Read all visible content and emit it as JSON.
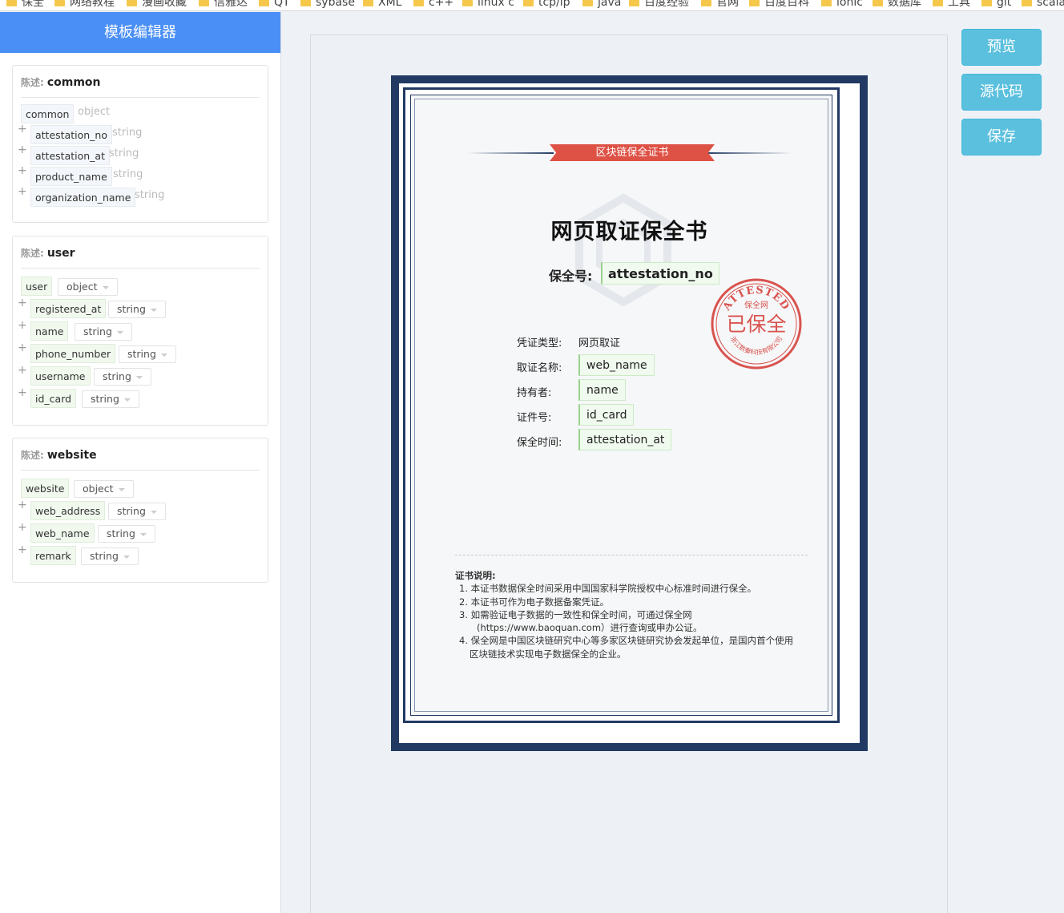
{
  "bookmarks": [
    "保全",
    "网络教程",
    "漫画收藏",
    "信雅达",
    "QT",
    "sybase",
    "XML",
    "c++",
    "linux c",
    "tcp/ip",
    "java",
    "百度经验",
    "官网",
    "百度百科",
    "ionic",
    "数据库",
    "工具",
    "git",
    "scala"
  ],
  "sidebar": {
    "title": "模板编辑器",
    "panels": [
      {
        "describe_label": "陈述:",
        "name": "common",
        "root": {
          "key": "common",
          "type": "object"
        },
        "fields": [
          {
            "key": "attestation_no",
            "type": "string"
          },
          {
            "key": "attestation_at",
            "type": "string"
          },
          {
            "key": "product_name",
            "type": "string"
          },
          {
            "key": "organization_name",
            "type": "string"
          }
        ]
      },
      {
        "describe_label": "陈述:",
        "name": "user",
        "root": {
          "key": "user",
          "type": "object"
        },
        "fields": [
          {
            "key": "registered_at",
            "type": "string"
          },
          {
            "key": "name",
            "type": "string"
          },
          {
            "key": "phone_number",
            "type": "string"
          },
          {
            "key": "username",
            "type": "string"
          },
          {
            "key": "id_card",
            "type": "string"
          }
        ]
      },
      {
        "describe_label": "陈述:",
        "name": "website",
        "root": {
          "key": "website",
          "type": "object"
        },
        "fields": [
          {
            "key": "web_address",
            "type": "string"
          },
          {
            "key": "web_name",
            "type": "string"
          },
          {
            "key": "remark",
            "type": "string"
          }
        ]
      }
    ]
  },
  "certificate": {
    "banner": "区块链保全证书",
    "title": "网页取证保全书",
    "no_label": "保全号:",
    "no_value": "attestation_no",
    "info": [
      {
        "label": "凭证类型:",
        "value": "网页取证",
        "is_field": false
      },
      {
        "label": "取证名称:",
        "value": "web_name",
        "is_field": true
      },
      {
        "label": "持有者:",
        "value": "name",
        "is_field": true
      },
      {
        "label": "证件号:",
        "value": "id_card",
        "is_field": true
      },
      {
        "label": "保全时间:",
        "value": "attestation_at",
        "is_field": true
      }
    ],
    "seal": {
      "top": "ATTESTED",
      "middle_small": "保全网",
      "main": "已保全",
      "bottom": "浙江数秦科技有限公司",
      "color": "#d9534f"
    },
    "notes_title": "证书说明:",
    "notes": [
      "1. 本证书数据保全时间采用中国国家科学院授权中心标准时间进行保全。",
      "2. 本证书可作为电子数据备案凭证。",
      "3. 如需验证电子数据的一致性和保全时间，可通过保全网",
      "(https://www.baoquan.com）进行查询或申办公证。",
      "4. 保全网是中国区块链研究中心等多家区块链研究协会发起单位，是国内首个使用",
      "区块链技术实现电子数据保全的企业。"
    ]
  },
  "buttons": {
    "preview": "预览",
    "source": "源代码",
    "save": "保存"
  },
  "colors": {
    "header_blue": "#4a8ff5",
    "button": "#5bc0de",
    "cert_border": "#223a63",
    "banner_red": "#de5145"
  }
}
